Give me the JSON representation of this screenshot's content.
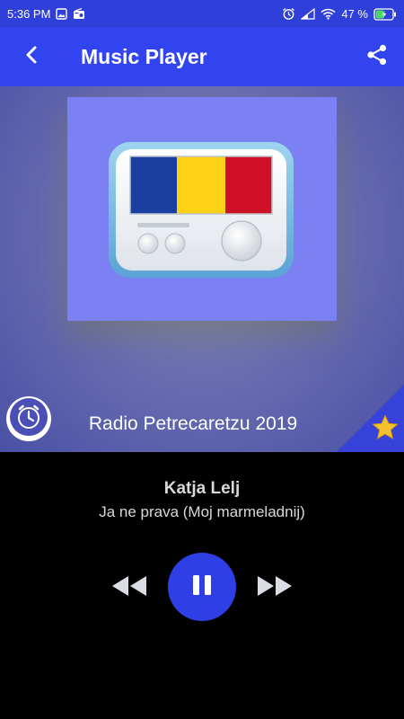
{
  "status_bar": {
    "time": "5:36 PM",
    "battery_percent": "47 %",
    "icons": [
      "image-icon",
      "radio-icon",
      "alarm-icon",
      "signal-icon",
      "wifi-icon",
      "battery-icon"
    ]
  },
  "app_bar": {
    "title": "Music Player",
    "back_icon": "back-arrow-icon",
    "share_icon": "share-icon"
  },
  "station": {
    "name": "Radio Petrecaretzu 2019",
    "logo_flag_colors": [
      "#1b3fa0",
      "#fcd116",
      "#ce1126"
    ]
  },
  "now_playing": {
    "artist": "Katja Lelj",
    "track": "Ja ne prava (Moj marmeladnij)"
  },
  "controls": {
    "rewind_icon": "rewind-icon",
    "pause_icon": "pause-icon",
    "forward_icon": "fast-forward-icon"
  },
  "colors": {
    "primary": "#3244f0",
    "status_bar": "#2f3fd9",
    "favorite_star": "#f2c12e"
  }
}
